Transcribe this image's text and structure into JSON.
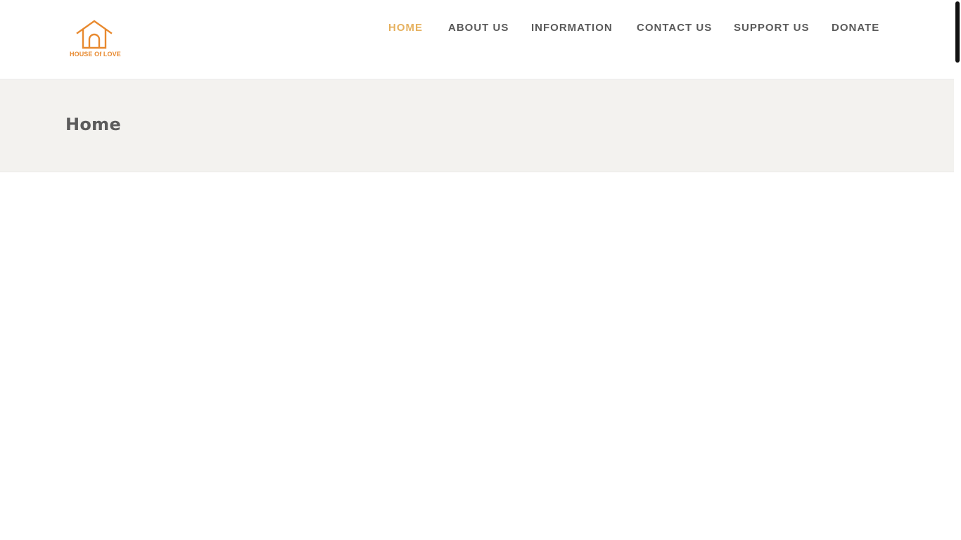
{
  "header": {
    "logo_text": "HOUSE Of LOVE",
    "brand_color": "#e8892e",
    "nav": {
      "home": "HOME",
      "about": "ABOUT US",
      "information": "INFORMATION",
      "contact": "CONTACT US",
      "support": "SUPPORT US",
      "donate": "DONATE"
    },
    "active_item": "HOME",
    "active_color": "#e6b15f",
    "nav_color": "#5a5a5a"
  },
  "title_bar": {
    "title": "Home",
    "background": "#f3f2ef"
  },
  "icons": {
    "logo": "house-icon"
  }
}
